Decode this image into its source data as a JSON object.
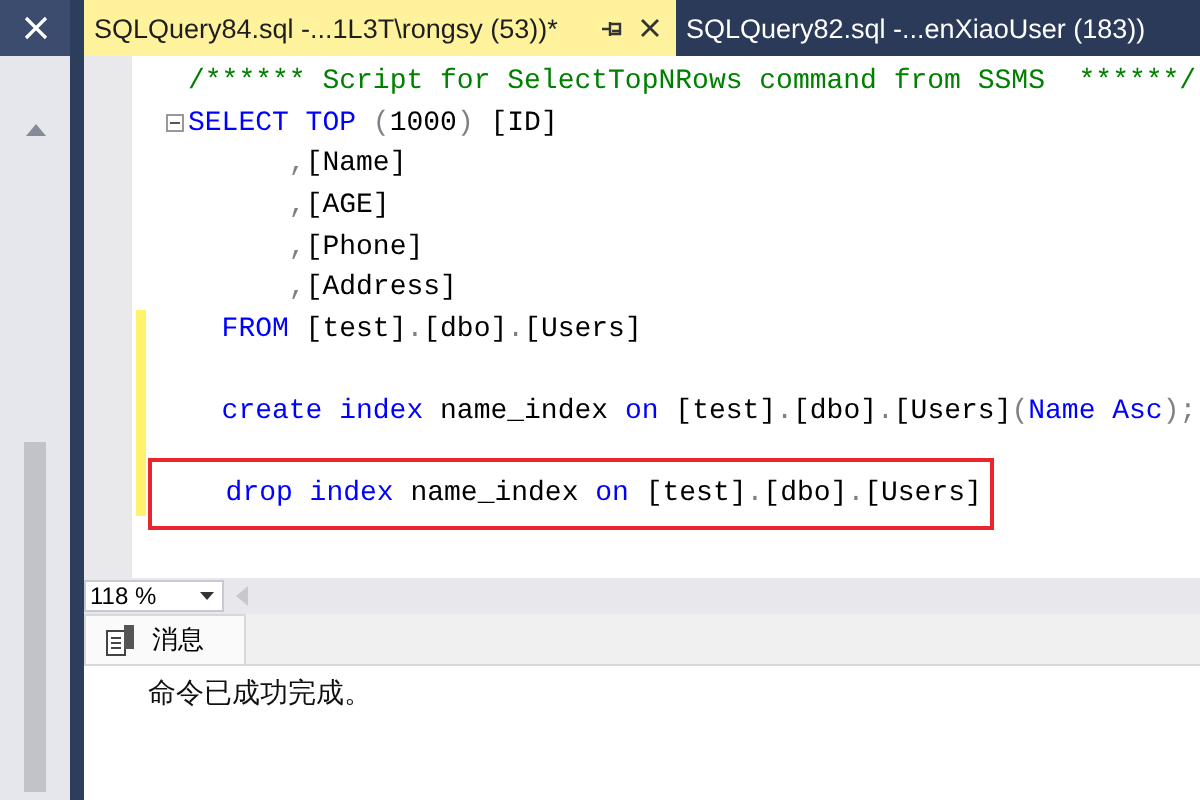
{
  "tabs": [
    {
      "label": "SQLQuery84.sql -...1L3T\\rongsy (53))*",
      "selected": true
    },
    {
      "label": "SQLQuery82.sql -...enXiaoUser (183))",
      "selected": false
    }
  ],
  "editor": {
    "lines": [
      {
        "kind": "top",
        "changed": false,
        "fold": false,
        "boxed": false,
        "tokens": [
          {
            "kind": "comment",
            "text": "/****** Script for SelectTopNRows command from SSMS  ******/"
          }
        ]
      },
      {
        "kind": "top",
        "changed": false,
        "fold": true,
        "boxed": false,
        "tokens": [
          {
            "kind": "keyword",
            "text": "SELECT TOP "
          },
          {
            "kind": "operator",
            "text": "("
          },
          {
            "kind": "plain",
            "text": "1000"
          },
          {
            "kind": "operator",
            "text": ")"
          },
          {
            "kind": "plain",
            "text": " [ID]"
          }
        ]
      },
      {
        "kind": "column",
        "changed": false,
        "fold": false,
        "boxed": false,
        "tokens": [
          {
            "kind": "operator",
            "text": ","
          },
          {
            "kind": "plain",
            "text": "[Name]"
          }
        ]
      },
      {
        "kind": "column",
        "changed": false,
        "fold": false,
        "boxed": false,
        "tokens": [
          {
            "kind": "operator",
            "text": ","
          },
          {
            "kind": "plain",
            "text": "[AGE]"
          }
        ]
      },
      {
        "kind": "column",
        "changed": false,
        "fold": false,
        "boxed": false,
        "tokens": [
          {
            "kind": "operator",
            "text": ","
          },
          {
            "kind": "plain",
            "text": "[Phone]"
          }
        ]
      },
      {
        "kind": "column",
        "changed": false,
        "fold": false,
        "boxed": false,
        "tokens": [
          {
            "kind": "operator",
            "text": ","
          },
          {
            "kind": "plain",
            "text": "[Address]"
          }
        ]
      },
      {
        "kind": "clause",
        "changed": true,
        "fold": false,
        "boxed": false,
        "tokens": [
          {
            "kind": "keyword",
            "text": "FROM"
          },
          {
            "kind": "plain",
            "text": " [test]"
          },
          {
            "kind": "operator",
            "text": "."
          },
          {
            "kind": "plain",
            "text": "[dbo]"
          },
          {
            "kind": "operator",
            "text": "."
          },
          {
            "kind": "plain",
            "text": "[Users]"
          }
        ]
      },
      {
        "changed": true,
        "fold": false,
        "boxed": false
      },
      {
        "kind": "clause",
        "changed": true,
        "fold": false,
        "boxed": false,
        "tokens": [
          {
            "kind": "keyword",
            "text": "create index"
          },
          {
            "kind": "plain",
            "text": " name_index "
          },
          {
            "kind": "keyword",
            "text": "on"
          },
          {
            "kind": "plain",
            "text": " [test]"
          },
          {
            "kind": "operator",
            "text": "."
          },
          {
            "kind": "plain",
            "text": "[dbo]"
          },
          {
            "kind": "operator",
            "text": "."
          },
          {
            "kind": "plain",
            "text": "[Users]"
          },
          {
            "kind": "operator",
            "text": "("
          },
          {
            "kind": "keyword",
            "text": "Name Asc"
          },
          {
            "kind": "operator",
            "text": ");"
          }
        ]
      },
      {
        "changed": true,
        "fold": false,
        "boxed": false
      },
      {
        "kind": "clause",
        "changed": true,
        "fold": false,
        "boxed": true,
        "tokens": [
          {
            "kind": "keyword",
            "text": "drop index"
          },
          {
            "kind": "plain",
            "text": " name_index "
          },
          {
            "kind": "keyword",
            "text": "on"
          },
          {
            "kind": "plain",
            "text": " [test]"
          },
          {
            "kind": "operator",
            "text": "."
          },
          {
            "kind": "plain",
            "text": "[dbo]"
          },
          {
            "kind": "operator",
            "text": "."
          },
          {
            "kind": "plain",
            "text": "[Users]"
          }
        ]
      }
    ]
  },
  "zoom": {
    "value": "118 %"
  },
  "results": {
    "tabs": [
      {
        "label": "消息",
        "selected": true
      }
    ],
    "message": "命令已成功完成。"
  }
}
